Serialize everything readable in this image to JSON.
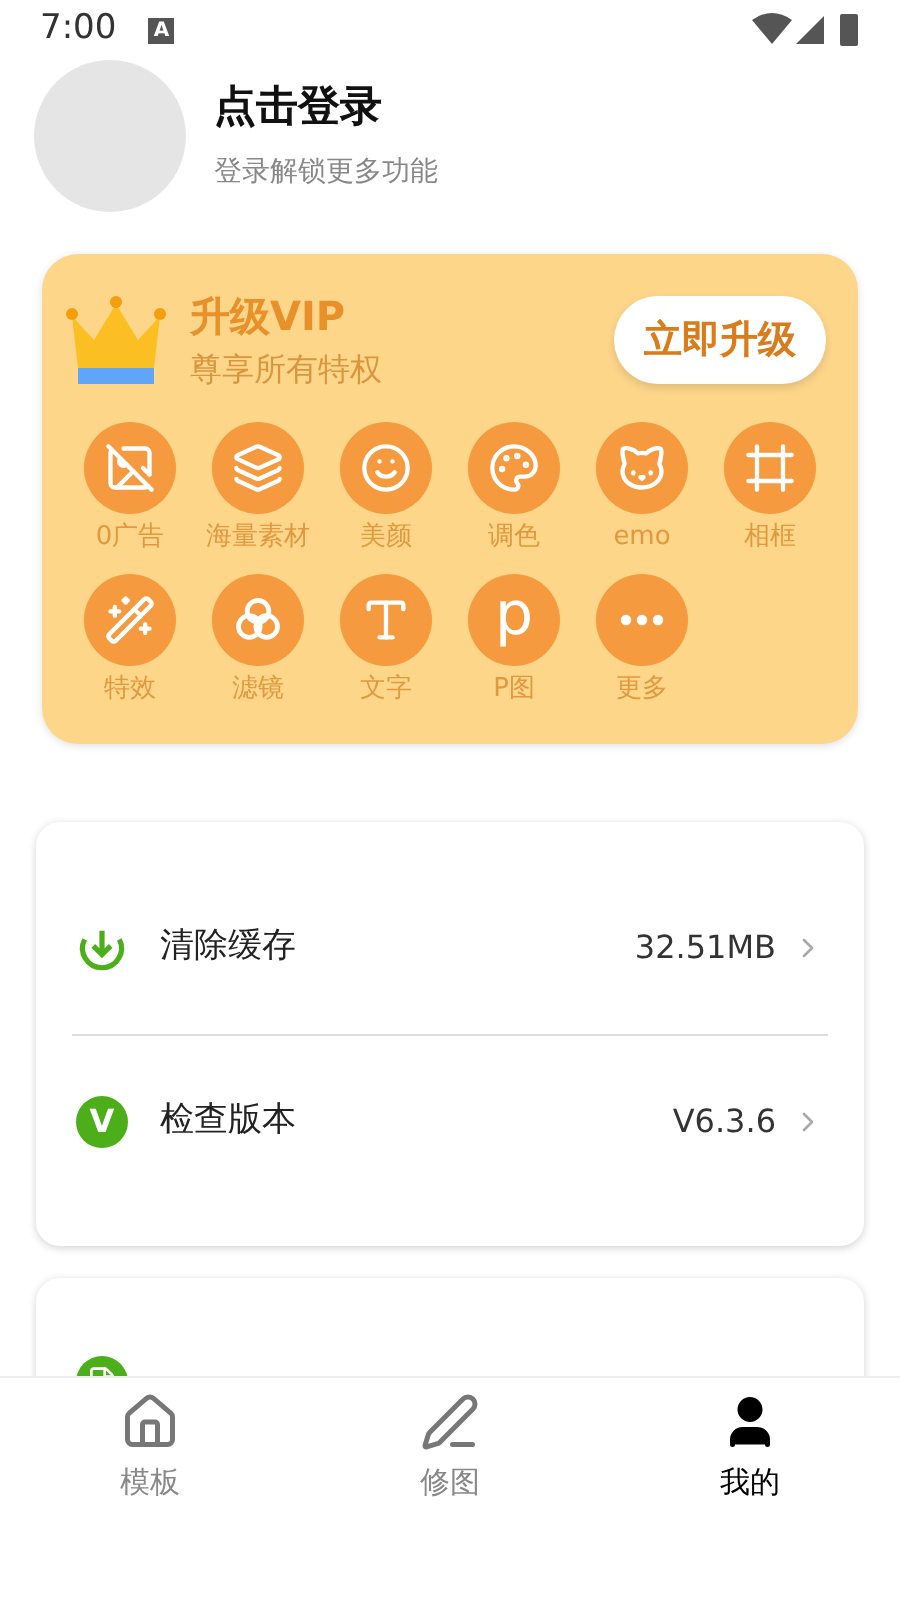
{
  "status_bar": {
    "time": "7:00",
    "badge": "A"
  },
  "profile": {
    "title": "点击登录",
    "subtitle": "登录解锁更多功能"
  },
  "vip": {
    "title": "升级VIP",
    "subtitle": "尊享所有特权",
    "button": "立即升级",
    "features": [
      {
        "label": "0广告",
        "kind": "noad"
      },
      {
        "label": "海量素材",
        "kind": "layers"
      },
      {
        "label": "美颜",
        "kind": "face"
      },
      {
        "label": "调色",
        "kind": "palette"
      },
      {
        "label": "emo",
        "kind": "emo"
      },
      {
        "label": "相框",
        "kind": "frame"
      },
      {
        "label": "特效",
        "kind": "wand"
      },
      {
        "label": "滤镜",
        "kind": "filter"
      },
      {
        "label": "文字",
        "kind": "text"
      },
      {
        "label": "P图",
        "kind": "p",
        "glyph": "p"
      },
      {
        "label": "更多",
        "kind": "more"
      }
    ]
  },
  "settings": [
    {
      "label": "清除缓存",
      "value": "32.51MB",
      "kind": "download"
    },
    {
      "label": "检查版本",
      "value": "V6.3.6",
      "kind": "version",
      "glyph": "V"
    }
  ],
  "more_settings": [
    {
      "kind": "doc"
    }
  ],
  "tabs": [
    {
      "label": "模板",
      "kind": "home",
      "selected": false
    },
    {
      "label": "修图",
      "kind": "edit",
      "selected": false
    },
    {
      "label": "我的",
      "kind": "user",
      "selected": true
    }
  ]
}
